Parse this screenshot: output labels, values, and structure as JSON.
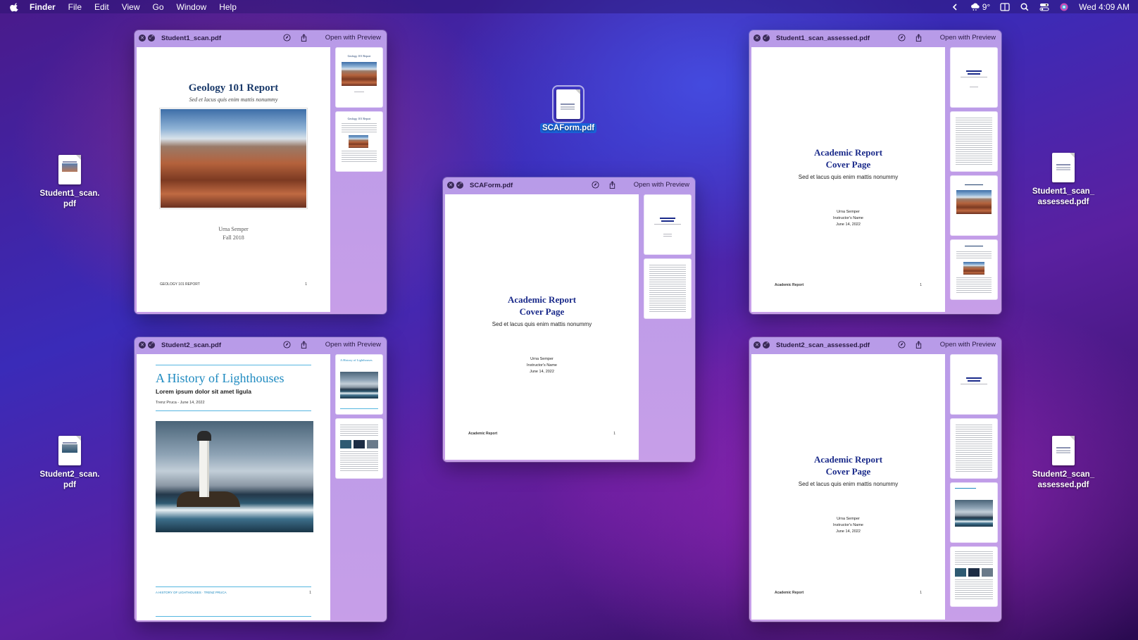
{
  "menubar": {
    "app": "Finder",
    "items": [
      "File",
      "Edit",
      "View",
      "Go",
      "Window",
      "Help"
    ],
    "weather": "9°",
    "clock": "Wed  4:09 AM"
  },
  "desktop": {
    "icons": [
      {
        "name": "Student1_scan.\npdf"
      },
      {
        "name": "Student2_scan.\npdf"
      },
      {
        "name": "SCAForm.pdf"
      },
      {
        "name": "Student1_scan_\nassessed.pdf"
      },
      {
        "name": "Student2_scan_\nassessed.pdf"
      }
    ]
  },
  "windows": {
    "student1": {
      "title": "Student1_scan.pdf",
      "open_label": "Open with Preview",
      "doc_title": "Geology 101 Report",
      "doc_subtitle": "Sed et lacus quis enim mattis nonummy",
      "author": "Urna Semper",
      "term": "Fall 2018",
      "footer_left": "GEOLOGY 101 REPORT",
      "footer_right": "1",
      "thumb1_title": "Geology 101 Report",
      "thumb2_title": "Geology 101 Report"
    },
    "student2": {
      "title": "Student2_scan.pdf",
      "open_label": "Open with Preview",
      "doc_title": "A History of Lighthouses",
      "doc_subtitle": "Lorem ipsum dolor sit amet ligula",
      "byline": "Trenz Pruca - June 14, 2022",
      "footer_left": "A HISTORY OF LIGHTHOUSES · TRENZ PRUCA",
      "footer_right": "1",
      "thumb1_title": "A History of Lighthouses"
    },
    "scaform": {
      "title": "SCAForm.pdf",
      "open_label": "Open with Preview",
      "doc_title_1": "Academic Report",
      "doc_title_2": "Cover Page",
      "doc_subtitle": "Sed et lacus quis enim mattis nonummy",
      "meta_1": "Urna Semper",
      "meta_2": "Instructor's Name",
      "meta_3": "June 14, 2022",
      "footer_left": "Academic Report",
      "footer_right": "1"
    },
    "student1_assessed": {
      "title": "Student1_scan_assessed.pdf",
      "open_label": "Open with Preview",
      "doc_title_1": "Academic Report",
      "doc_title_2": "Cover Page",
      "doc_subtitle": "Sed et lacus quis enim mattis nonummy",
      "meta_1": "Urna Semper",
      "meta_2": "Instructor's Name",
      "meta_3": "June 14, 2022",
      "footer_left": "Academic Report",
      "footer_right": "1"
    },
    "student2_assessed": {
      "title": "Student2_scan_assessed.pdf",
      "open_label": "Open with Preview",
      "doc_title_1": "Academic Report",
      "doc_title_2": "Cover Page",
      "doc_subtitle": "Sed et lacus quis enim mattis nonummy",
      "meta_1": "Urna Semper",
      "meta_2": "Instructor's Name",
      "meta_3": "June 14, 2022",
      "footer_left": "Academic Report",
      "footer_right": "1"
    }
  },
  "icons": {
    "close": "close-icon",
    "fullscreen": "fullscreen-icon",
    "markup": "markup-icon",
    "share": "share-icon"
  },
  "colors": {
    "selection": "#1a63d8",
    "window_tint": "#b89be8",
    "academic_title": "#1a2a8a",
    "lighthouse_blue": "#1e8ac0"
  }
}
